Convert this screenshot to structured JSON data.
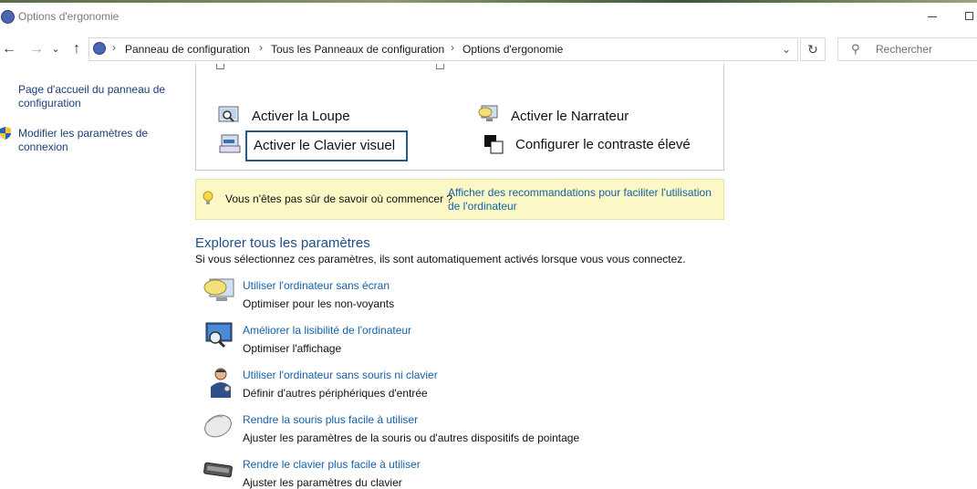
{
  "window": {
    "title": "Options d'ergonomie"
  },
  "nav": {
    "back_glyph": "←",
    "forward_glyph": "→",
    "recent_glyph": "⌄",
    "up_glyph": "↑",
    "breadcrumb": [
      "Panneau de configuration",
      "Tous les Panneaux de configuration",
      "Options d'ergonomie"
    ],
    "separator": "›",
    "dropdown_glyph": "⌄",
    "refresh_glyph": "↻",
    "search_placeholder": "Rechercher",
    "search_glyph": "⚲"
  },
  "sidebar": {
    "items": [
      {
        "label": "Page d'accueil du panneau de configuration"
      },
      {
        "label": "Modifier les paramètres de connexion"
      }
    ]
  },
  "quick": {
    "loupe": "Activer la Loupe",
    "narrateur": "Activer le Narrateur",
    "clavier": "Activer le Clavier visuel",
    "contraste": "Configurer le contraste élevé"
  },
  "tip": {
    "text": "Vous n'êtes pas sûr de savoir où commencer ?",
    "link": "Afficher des recommandations pour faciliter l'utilisation de l'ordinateur"
  },
  "explore": {
    "title": "Explorer tous les paramètres",
    "subtitle": "Si vous sélectionnez ces paramètres, ils sont automatiquement activés lorsque vous vous connectez.",
    "items": [
      {
        "link": "Utiliser l'ordinateur sans écran",
        "desc": "Optimiser pour les non-voyants",
        "icon": "speech-bubble-icon"
      },
      {
        "link": "Améliorer la lisibilité de l'ordinateur",
        "desc": "Optimiser l'affichage",
        "icon": "monitor-magnifier-icon"
      },
      {
        "link": "Utiliser l'ordinateur sans souris ni clavier",
        "desc": "Définir d'autres périphériques d'entrée",
        "icon": "person-icon"
      },
      {
        "link": "Rendre la souris plus facile à utiliser",
        "desc": "Ajuster les paramètres de la souris ou d'autres dispositifs de pointage",
        "icon": "mouse-icon"
      },
      {
        "link": "Rendre le clavier plus facile à utiliser",
        "desc": "Ajuster les paramètres du clavier",
        "icon": "keyboard-icon"
      }
    ]
  }
}
